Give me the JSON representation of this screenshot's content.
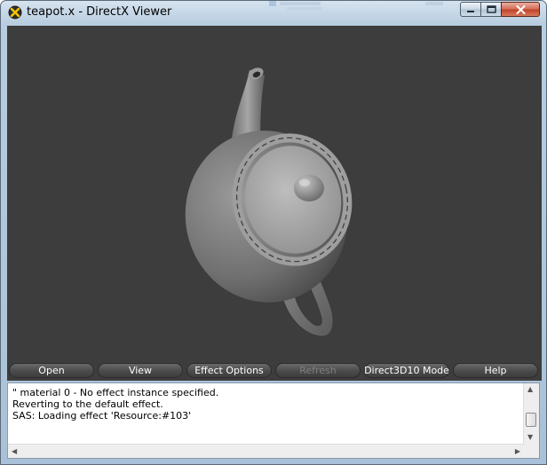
{
  "window": {
    "title": "teapot.x - DirectX Viewer",
    "app_icon": "directx-x-icon"
  },
  "toolbar": {
    "buttons": [
      {
        "label": "Open",
        "enabled": true
      },
      {
        "label": "View",
        "enabled": true
      },
      {
        "label": "Effect Options",
        "enabled": true
      },
      {
        "label": "Refresh",
        "enabled": false
      },
      {
        "label": "Direct3D10 Mode",
        "enabled": true
      },
      {
        "label": "Help",
        "enabled": true
      }
    ]
  },
  "log": {
    "lines": [
      "\" material 0 - No effect instance specified.",
      "Reverting to the default effect.",
      "SAS: Loading effect 'Resource:#103'"
    ]
  },
  "colors": {
    "viewport_bg": "#3d3d3d",
    "button_text": "#ffffff",
    "button_disabled_text": "#7e7e7e",
    "close_button": "#c2432a"
  }
}
